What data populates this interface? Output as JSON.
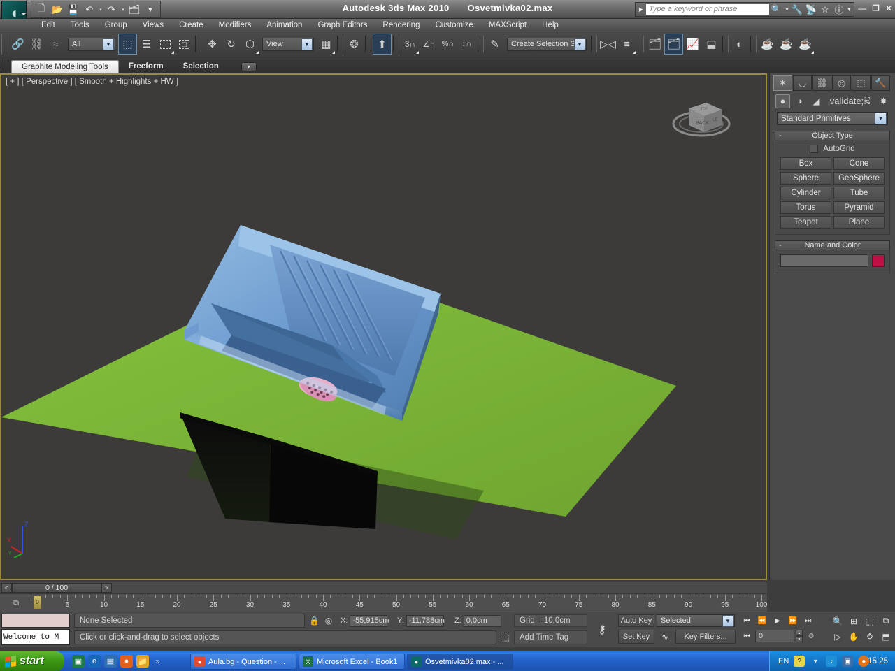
{
  "titlebar": {
    "app_title": "Autodesk 3ds Max  2010",
    "file_name": "Osvetmivka02.max",
    "logo_icon": "max-logo-icon",
    "quick_access": [
      {
        "name": "new-file-button",
        "glyph": "⬜"
      },
      {
        "name": "open-file-button",
        "glyph": "📂"
      },
      {
        "name": "save-file-button",
        "glyph": "💾"
      },
      {
        "name": "undo-button",
        "glyph": "↶"
      },
      {
        "name": "undo-dropdown",
        "glyph": "▾"
      },
      {
        "name": "redo-button",
        "glyph": "↷"
      },
      {
        "name": "redo-dropdown",
        "glyph": "▾"
      },
      {
        "name": "set-project-folder-button",
        "glyph": "🗂"
      },
      {
        "name": "qat-overflow-button",
        "glyph": "▼"
      }
    ],
    "window_buttons": {
      "minimize": "—",
      "restore": "❐",
      "close": "✕"
    }
  },
  "infocenter": {
    "placeholder": "Type a keyword or phrase",
    "value": "",
    "expand_caret": "▶",
    "icons": [
      {
        "name": "search-icon",
        "glyph": "🔍"
      },
      {
        "name": "search-dropdown-icon",
        "glyph": "▾"
      },
      {
        "name": "subscription-center-icon",
        "glyph": "🔧"
      },
      {
        "name": "communication-center-icon",
        "glyph": "📡"
      },
      {
        "name": "favorites-icon",
        "glyph": "★"
      },
      {
        "name": "help-icon",
        "glyph": "?"
      },
      {
        "name": "help-dropdown-icon",
        "glyph": "▾"
      }
    ]
  },
  "menubar": {
    "items": [
      "Edit",
      "Tools",
      "Group",
      "Views",
      "Create",
      "Modifiers",
      "Animation",
      "Graph Editors",
      "Rendering",
      "Customize",
      "MAXScript",
      "Help"
    ]
  },
  "toolbar": {
    "selection_filter": {
      "value": "All",
      "name": "selection-filter-combo"
    },
    "reference_coord": {
      "value": "View",
      "name": "reference-coordinate-system-combo"
    },
    "named_selection_set": {
      "value": "Create Selection Se",
      "name": "named-selection-set-combo"
    },
    "groups": [
      [
        {
          "name": "select-and-link-icon",
          "glyph": "🔗"
        },
        {
          "name": "unlink-selection-icon",
          "glyph": "⛓"
        },
        {
          "name": "bind-to-space-warp-icon",
          "glyph": "≈"
        }
      ],
      [
        {
          "name": "select-object-icon",
          "glyph": "⬚",
          "active": true
        },
        {
          "name": "select-by-name-icon",
          "glyph": "☰"
        },
        {
          "name": "rectangular-selection-region-icon",
          "glyph": "▭"
        },
        {
          "name": "window-crossing-icon",
          "glyph": "▧"
        }
      ],
      [
        {
          "name": "select-and-move-icon",
          "glyph": "✥"
        },
        {
          "name": "select-and-rotate-icon",
          "glyph": "↻"
        },
        {
          "name": "select-and-scale-icon",
          "glyph": "⤡"
        }
      ],
      [
        {
          "name": "mirror-icon",
          "glyph": "◧"
        },
        {
          "name": "align-icon",
          "glyph": "≡"
        }
      ],
      [
        {
          "name": "use-pivot-point-center-icon",
          "glyph": "✲"
        },
        {
          "name": "manipulate-icon",
          "glyph": "⬆"
        }
      ],
      [
        {
          "name": "snaps-toggle-icon",
          "glyph": "3"
        },
        {
          "name": "angle-snap-toggle-icon",
          "glyph": "∠"
        },
        {
          "name": "percent-snap-toggle-icon",
          "glyph": "%"
        },
        {
          "name": "spinner-snap-toggle-icon",
          "glyph": "↕"
        }
      ],
      [
        {
          "name": "edit-named-selection-sets-icon",
          "glyph": "✎"
        }
      ],
      [
        {
          "name": "mirror-tool-icon",
          "glyph": "▷◁"
        },
        {
          "name": "align-tool-icon",
          "glyph": "⬒"
        }
      ],
      [
        {
          "name": "layer-manager-icon",
          "glyph": "🗂"
        },
        {
          "name": "material-editor-icon",
          "glyph": "⚿",
          "active": true
        },
        {
          "name": "curve-editor-icon",
          "glyph": "📈"
        },
        {
          "name": "schematic-view-icon",
          "glyph": "⬓"
        }
      ],
      [
        {
          "name": "render-setup-icon",
          "glyph": "◐"
        }
      ],
      [
        {
          "name": "render-frame-window-icon",
          "glyph": "☕"
        },
        {
          "name": "render-production-icon",
          "glyph": "☕"
        },
        {
          "name": "render-iterative-icon",
          "glyph": "☕"
        }
      ]
    ]
  },
  "ribbon": {
    "tabs": [
      {
        "label": "Graphite Modeling Tools",
        "selected": true
      },
      {
        "label": "Freeform",
        "selected": false
      },
      {
        "label": "Selection",
        "selected": false
      }
    ],
    "overflow_caret": "▾"
  },
  "viewport": {
    "label": "[ + ] [ Perspective ] [ Smooth + Highlights + HW ]",
    "viewcube_faces": {
      "front": "BACK",
      "top": "TOP",
      "right": "LEFT"
    },
    "axis_tripod": {
      "z": "Z",
      "x": "X",
      "y": "Y"
    },
    "colors": {
      "background": "#3d3b39",
      "ground_plane": "#79b338",
      "sink_body": "#6e9fd2",
      "sink_dark": "#4a74a8",
      "drain_strainer": "#e3a6c2",
      "border": "#9a8a3d"
    },
    "scene_objects": [
      "kitchen-sink",
      "ground-plane"
    ]
  },
  "command_panel": {
    "tabs": [
      {
        "name": "create-tab",
        "glyph": "✦",
        "selected": true
      },
      {
        "name": "modify-tab",
        "glyph": "◡"
      },
      {
        "name": "hierarchy-tab",
        "glyph": "⛓"
      },
      {
        "name": "motion-tab",
        "glyph": "◎"
      },
      {
        "name": "display-tab",
        "glyph": "⬜"
      },
      {
        "name": "utilities-tab",
        "glyph": "🔨"
      }
    ],
    "categories": [
      {
        "name": "geometry-category-icon",
        "glyph": "●",
        "selected": true
      },
      {
        "name": "shapes-category-icon",
        "glyph": "◑"
      },
      {
        "name": "lights-category-icon",
        "glyph": "◢"
      },
      {
        "name": "cameras-category-icon",
        "glyph": "🎥"
      },
      {
        "name": "helpers-category-icon",
        "glyph": "⌖"
      },
      {
        "name": "space-warps-category-icon",
        "glyph": "≈"
      },
      {
        "name": "systems-category-icon",
        "glyph": "✸"
      }
    ],
    "subcategory": "Standard Primitives",
    "rollouts": [
      {
        "title": "Object Type",
        "minus": "-",
        "autogrid_label": "AutoGrid",
        "autogrid_checked": false,
        "buttons": [
          "Box",
          "Cone",
          "Sphere",
          "GeoSphere",
          "Cylinder",
          "Tube",
          "Torus",
          "Pyramid",
          "Teapot",
          "Plane"
        ]
      },
      {
        "title": "Name and Color",
        "minus": "-",
        "name_value": "",
        "color_swatch": "#bf1045"
      }
    ]
  },
  "time_slider": {
    "prev_frame": "<",
    "next_frame": ">",
    "frame_display": "0 / 100",
    "track_icon": "⧉"
  },
  "ruler": {
    "labels": [
      5,
      10,
      15,
      20,
      25,
      30,
      35,
      40,
      45,
      50,
      55,
      60,
      65,
      70,
      75,
      80,
      85,
      90,
      95,
      100
    ],
    "min": 0,
    "max": 100,
    "current": 0,
    "thumb_label": "0"
  },
  "statusbar": {
    "mini_listener_value": "",
    "welcome_text": "Welcome to M",
    "selection_status": "None Selected",
    "prompt": "Click or click-and-drag to select objects",
    "lock_icon": "🔒",
    "selection_lock_icon": "⬚",
    "coordinates": [
      {
        "axis": "X:",
        "value": "-55,915cm"
      },
      {
        "axis": "Y:",
        "value": "-11,788cm"
      },
      {
        "axis": "Z:",
        "value": "0,0cm"
      }
    ],
    "grid_label": "Grid = 10,0cm",
    "add_time_tag": "Add Time Tag",
    "time_tag_icon": "⬚",
    "key_mode_icon": "⚷"
  },
  "animation": {
    "auto_key": "Auto Key",
    "set_key": "Set Key",
    "key_filters": "Key Filters...",
    "selection_level": "Selected",
    "curve_icon": "∿",
    "frame_field": "0",
    "playback": [
      {
        "name": "go-to-start-button",
        "glyph": "⏮"
      },
      {
        "name": "previous-frame-button",
        "glyph": "⏴"
      },
      {
        "name": "play-animation-button",
        "glyph": "▶"
      },
      {
        "name": "next-frame-button",
        "glyph": "⏵"
      },
      {
        "name": "go-to-end-button",
        "glyph": "⏭"
      }
    ],
    "key_mode_toggle": "⏭"
  },
  "nav_controls": {
    "row1": [
      {
        "name": "zoom-button",
        "glyph": "🔍"
      },
      {
        "name": "zoom-all-button",
        "glyph": "⊞"
      },
      {
        "name": "zoom-extents-button",
        "glyph": "⬚"
      },
      {
        "name": "zoom-extents-all-button",
        "glyph": "⧉"
      }
    ],
    "row2": [
      {
        "name": "field-of-view-button",
        "glyph": "▷"
      },
      {
        "name": "pan-view-button",
        "glyph": "✋"
      },
      {
        "name": "orbit-button",
        "glyph": "⥁"
      },
      {
        "name": "maximize-viewport-button",
        "glyph": "⬒"
      }
    ],
    "time_config_icon": "⏱"
  },
  "taskbar": {
    "start_label": "start",
    "quick_launch": [
      {
        "name": "quicklaunch-media-icon",
        "glyph": "▣",
        "color": "#1f7a4d"
      },
      {
        "name": "quicklaunch-internet-explorer-icon",
        "glyph": "e",
        "color": "#1767b8"
      },
      {
        "name": "quicklaunch-show-desktop-icon",
        "glyph": "▤",
        "color": "#2f6fb0"
      },
      {
        "name": "quicklaunch-firefox-icon",
        "glyph": "●",
        "color": "#e2601a"
      },
      {
        "name": "quicklaunch-folder-icon",
        "glyph": "📁",
        "color": "#e0a62c"
      }
    ],
    "overflow_chevron": "»",
    "windows": [
      {
        "title": "Aula.bg - Question - ...",
        "icon_glyph": "●",
        "icon_color": "#e04a2f",
        "active": false
      },
      {
        "title": "Microsoft Excel - Book1",
        "icon_glyph": "X",
        "icon_color": "#1d7044",
        "active": false
      },
      {
        "title": "Osvetmivka02.max - ...",
        "icon_glyph": "●",
        "icon_color": "#0d6b66",
        "active": true
      }
    ],
    "tray": {
      "language": "EN",
      "icons": [
        {
          "name": "help-tray-icon",
          "glyph": "?",
          "color": "#e8d44a"
        },
        {
          "name": "tray-expand-icon",
          "glyph": "▾",
          "color": "transparent"
        },
        {
          "name": "tray-back-icon",
          "glyph": "‹",
          "color": "#1f8fd8"
        },
        {
          "name": "network-tray-icon",
          "glyph": "▣",
          "color": "#3b6ea8"
        },
        {
          "name": "update-tray-icon",
          "glyph": "●",
          "color": "#e07318"
        }
      ],
      "clock": "15:25"
    }
  }
}
